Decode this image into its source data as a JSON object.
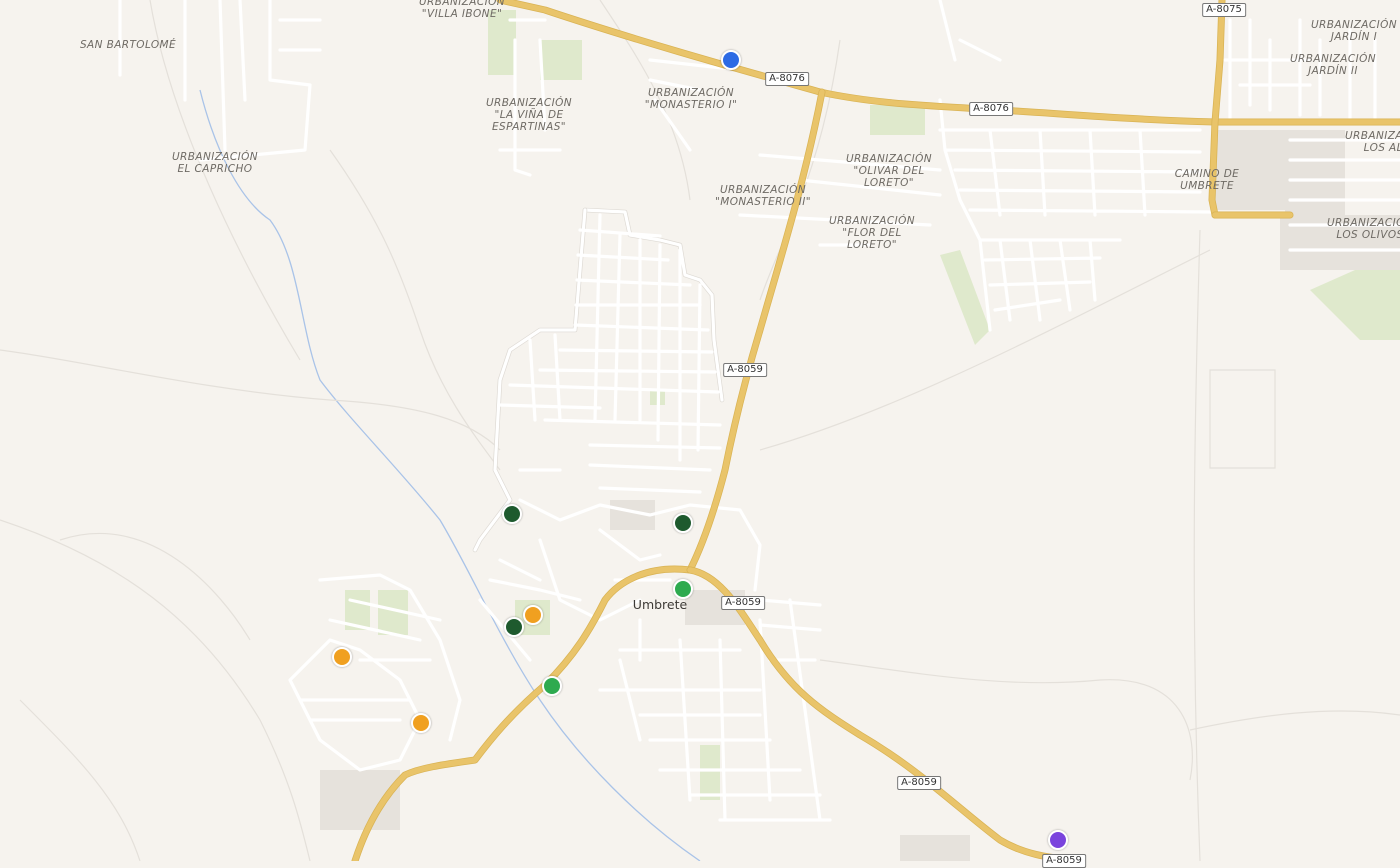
{
  "map": {
    "place_labels": [
      {
        "text": "SAN BARTOLOMÉ"
      },
      {
        "text": "URBANIZACIÓN\n\"VILLA IBONE\""
      },
      {
        "text": "URBANIZACIÓN\n\"LA VIÑA DE\nESPARTINAS\""
      },
      {
        "text": "URBANIZACIÓN\nEL CAPRICHO"
      },
      {
        "text": "URBANIZACIÓN\n\"MONASTERIO I\""
      },
      {
        "text": "URBANIZACIÓN\n\"MONASTERIO II\""
      },
      {
        "text": "URBANIZACIÓN\n\"OLIVAR DEL\nLORETO\""
      },
      {
        "text": "URBANIZACIÓN\n\"FLOR DEL\nLORETO\""
      },
      {
        "text": "CAMINO DE\nUMBRETE"
      },
      {
        "text": "URBANIZACIÓN\nJARDÍN I"
      },
      {
        "text": "URBANIZACIÓN\nJARDÍN II"
      },
      {
        "text": "URBANIZACIÓN\nLOS ALM"
      },
      {
        "text": "URBANIZACIÓN\nLOS OLIVOS"
      }
    ],
    "town_name": "Umbrete",
    "road_shields": [
      {
        "text": "A-8075"
      },
      {
        "text": "A-8076"
      },
      {
        "text": "A-8076"
      },
      {
        "text": "A-8059"
      },
      {
        "text": "A-8059"
      },
      {
        "text": "A-8059"
      },
      {
        "text": "A-8059"
      }
    ],
    "markers": [
      {
        "category": "blue",
        "color": "#2d6be4"
      },
      {
        "category": "dark-green",
        "color": "#1e5a2e"
      },
      {
        "category": "dark-green",
        "color": "#1e5a2e"
      },
      {
        "category": "green",
        "color": "#2eaa4f"
      },
      {
        "category": "orange",
        "color": "#f0a020"
      },
      {
        "category": "dark-green",
        "color": "#1e5a2e"
      },
      {
        "category": "orange",
        "color": "#f0a020"
      },
      {
        "category": "green",
        "color": "#2eaa4f"
      },
      {
        "category": "orange",
        "color": "#f0a020"
      },
      {
        "category": "purple",
        "color": "#7a44dd"
      }
    ]
  }
}
